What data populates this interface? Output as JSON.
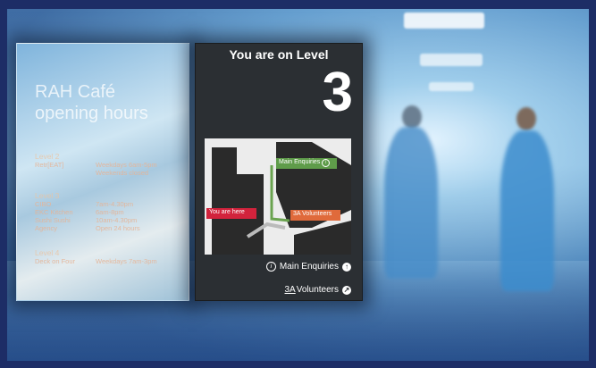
{
  "left_sign": {
    "title": "RAH Café",
    "subtitle": "opening hours",
    "sections": [
      {
        "level": "Level 2",
        "rows": [
          {
            "name": "Retr[EAT]",
            "hours": "Weekdays 6am-5pm"
          },
          {
            "name": "",
            "hours": "Weekends closed"
          }
        ]
      },
      {
        "level": "Level 3",
        "rows": [
          {
            "name": "CIBO",
            "hours": "7am-4.30pm"
          },
          {
            "name": "EKC Kitchen",
            "hours": "6am-8pm"
          },
          {
            "name": "Sushi Sushi",
            "hours": "10am-4.30pm"
          },
          {
            "name": "Agency",
            "hours": "Open 24 hours"
          }
        ]
      },
      {
        "level": "Level 4",
        "rows": [
          {
            "name": "Deck on Four",
            "hours": "Weekdays 7am-3pm"
          }
        ]
      }
    ]
  },
  "right_sign": {
    "heading": "You are on Level",
    "level": "3",
    "map": {
      "you_are_here": "You are here",
      "main_enquiries": "Main Enquiries",
      "main_enquiries_marker": "i",
      "volunteers": "Volunteers",
      "volunteers_marker": "3A"
    },
    "directions": [
      {
        "label": "Main Enquiries",
        "prefix": "i",
        "arrow_icon": "arrow-up-icon"
      },
      {
        "label": "Volunteers",
        "prefix": "3A",
        "arrow_icon": "arrow-up-right-icon"
      }
    ]
  },
  "colors": {
    "frame": "#1d2d66",
    "sign_dark": "#2b2f33",
    "you_are_here": "#d2233c",
    "enquiries": "#5f9c4a",
    "volunteers": "#e06a3b"
  }
}
